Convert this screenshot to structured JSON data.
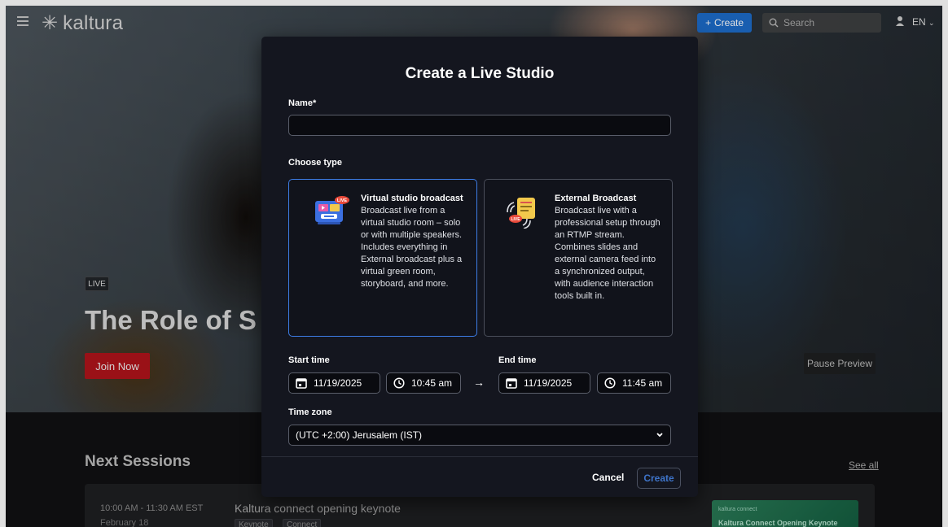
{
  "app": {
    "brand": "kaltura",
    "create_label": "Create",
    "search_placeholder": "Search",
    "language": "EN",
    "accent_color": "#1d6bc9"
  },
  "hero": {
    "badge": "LIVE",
    "title": "The Role of S",
    "join_label": "Join Now",
    "pause_label": "Pause Preview"
  },
  "sessions": {
    "heading": "Next Sessions",
    "see_all": "See all",
    "items": [
      {
        "time": "10:00 AM - 11:30 AM EST",
        "date": "February 18",
        "title": "Kaltura connect opening keynote",
        "tags": [
          "Keynote",
          "Connect"
        ],
        "thumb_brand": "kaltura connect",
        "thumb_title": "Kaltura Connect Opening Keynote"
      }
    ]
  },
  "modal": {
    "title": "Create a Live Studio",
    "name_label": "Name",
    "name_required_mark": "*",
    "name_value": "",
    "choose_type_label": "Choose type",
    "types": [
      {
        "name": "Virtual studio broadcast",
        "description": "Broadcast live from a virtual studio room – solo or with multiple speakers. Includes everything in External broadcast plus a virtual green room, storyboard, and more.",
        "selected": true,
        "icon": "virtual-studio-icon",
        "icon_badge": "LIVE"
      },
      {
        "name": "External Broadcast",
        "description": "Broadcast live with a professional setup through an RTMP stream. Combines slides and external camera feed into a synchronized output, with audience interaction tools built in.",
        "selected": false,
        "icon": "external-broadcast-icon",
        "icon_badge": "LIVE"
      }
    ],
    "start_label": "Start time",
    "start_date": "11/19/2025",
    "start_time": "10:45 am",
    "end_label": "End time",
    "end_date": "11/19/2025",
    "end_time": "11:45 am",
    "timezone_label": "Time zone",
    "timezone_value": "(UTC +2:00) Jerusalem (IST)",
    "cancel_label": "Cancel",
    "create_label": "Create"
  }
}
